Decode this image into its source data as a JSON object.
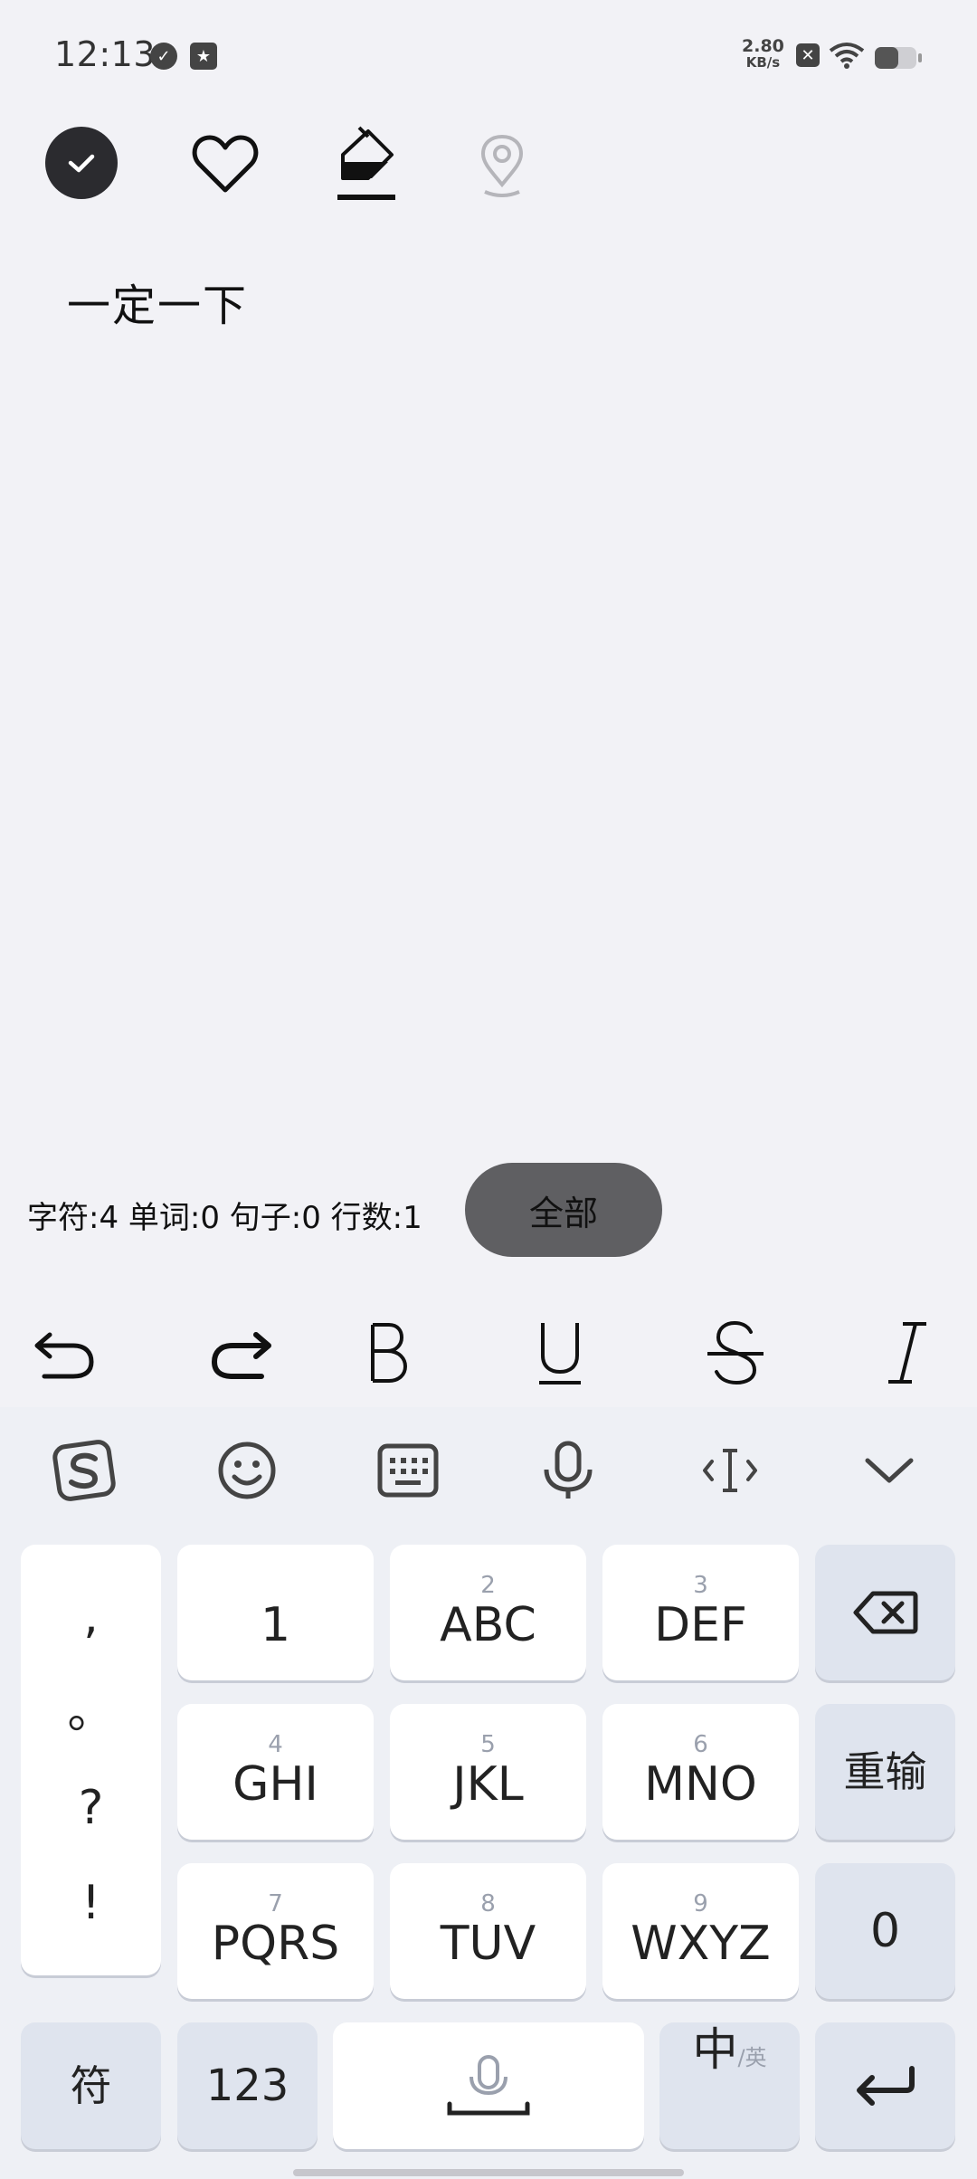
{
  "status_bar": {
    "time": "12:13",
    "net_speed_value": "2.80",
    "net_speed_unit": "KB/s",
    "icons": [
      "check-circle-icon",
      "star-badge-icon",
      "sim-blocked-icon",
      "wifi-icon",
      "battery-icon"
    ]
  },
  "toolbar": {
    "icons": [
      "check-icon",
      "heart-icon",
      "paint-bucket-icon",
      "location-pin-icon"
    ]
  },
  "editor": {
    "text": "一定一下"
  },
  "stats": {
    "text": "字符:4 单词:0 句子:0 行数:1",
    "all_button_label": "全部"
  },
  "format_bar": {
    "icons": [
      "undo-icon",
      "redo-icon",
      "bold-icon",
      "underline-icon",
      "strikethrough-icon",
      "italic-icon"
    ]
  },
  "keyboard": {
    "toolbar_icons": [
      "sogou-logo-icon",
      "emoji-icon",
      "keyboard-icon",
      "microphone-icon",
      "cursor-move-icon",
      "chevron-down-icon"
    ],
    "punct": [
      ",",
      "。",
      "?",
      "!"
    ],
    "keys": {
      "k1": {
        "num": "",
        "label": "1"
      },
      "k2": {
        "num": "2",
        "label": "ABC"
      },
      "k3": {
        "num": "3",
        "label": "DEF"
      },
      "k4": {
        "num": "4",
        "label": "GHI"
      },
      "k5": {
        "num": "5",
        "label": "JKL"
      },
      "k6": {
        "num": "6",
        "label": "MNO"
      },
      "k7": {
        "num": "7",
        "label": "PQRS"
      },
      "k8": {
        "num": "8",
        "label": "TUV"
      },
      "k9": {
        "num": "9",
        "label": "WXYZ"
      }
    },
    "reinput_label": "重输",
    "zero_label": "0",
    "symbol_label": "符",
    "num_label": "123",
    "lang_main": "中",
    "lang_sub": "/英"
  },
  "colors": {
    "background": "#f2f2f6",
    "keyboard_bg": "#eef0f5",
    "func_key": "#dfe4ee",
    "all_button": "#5f5f62"
  }
}
